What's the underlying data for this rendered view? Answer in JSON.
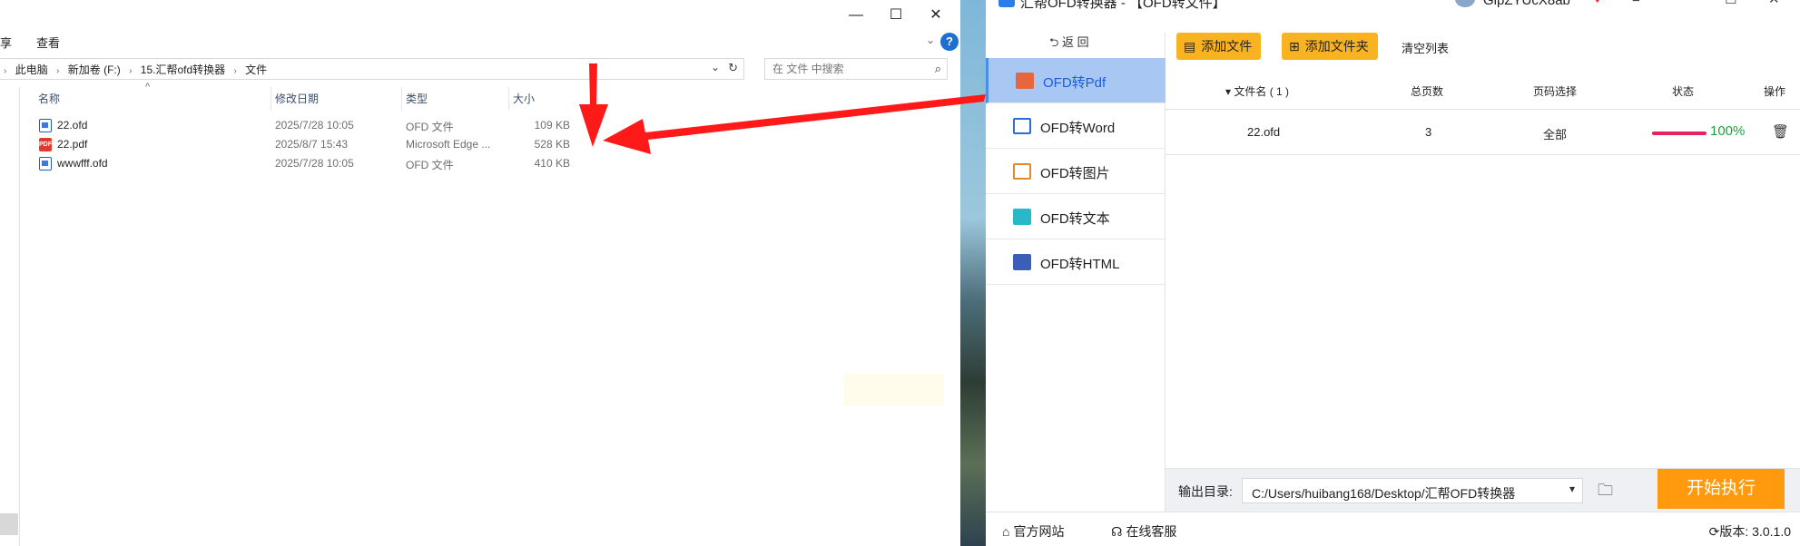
{
  "explorer": {
    "menu": {
      "share": "享",
      "view": "查看",
      "help": "?",
      "expand": "⌄"
    },
    "window_controls": {
      "minimize": "—",
      "maximize": "☐",
      "close": "✕"
    },
    "address": {
      "crumbs": [
        "此电脑",
        "新加卷 (F:)",
        "15.汇帮ofd转换器",
        "文件"
      ],
      "dropdown": "⌄",
      "refresh": "↻"
    },
    "search": {
      "placeholder": "在 文件 中搜索",
      "icon": "⌕"
    },
    "columns": {
      "name": "名称",
      "date": "修改日期",
      "type": "类型",
      "size": "大小",
      "sort": "^"
    },
    "files": [
      {
        "name": "22.ofd",
        "date": "2025/7/28 10:05",
        "type": "OFD 文件",
        "size": "109 KB",
        "icon": "ofd-file-icon"
      },
      {
        "name": "22.pdf",
        "date": "2025/8/7 15:43",
        "type": "Microsoft Edge ...",
        "size": "528 KB",
        "icon": "pdf-file-icon",
        "badge": "PDF"
      },
      {
        "name": "wwwfff.ofd",
        "date": "2025/7/28 10:05",
        "type": "OFD 文件",
        "size": "410 KB",
        "icon": "ofd-file-icon"
      }
    ]
  },
  "app": {
    "title": "汇帮OFD转换器 - 【OFD转文件】",
    "user": "GlpZYUcX8ab",
    "window_controls": {
      "menu": "≡",
      "minimize": "—",
      "maximize": "☐",
      "close": "✕"
    },
    "back": "⮌ 返 回",
    "sidebar": [
      {
        "label": "OFD转Pdf",
        "icon": "pdf-icon",
        "color": "#e8663d",
        "active": true
      },
      {
        "label": "OFD转Word",
        "icon": "word-icon",
        "color": "#2b6fd6"
      },
      {
        "label": "OFD转图片",
        "icon": "image-icon",
        "color": "#e08a2e"
      },
      {
        "label": "OFD转文本",
        "icon": "text-icon",
        "color": "#27b9c8"
      },
      {
        "label": "OFD转HTML",
        "icon": "html-icon",
        "color": "#3b5fb8"
      }
    ],
    "toolbar": {
      "add_file": "添加文件",
      "add_folder": "添加文件夹",
      "clear": "清空列表"
    },
    "table": {
      "headers": {
        "filename": "▾ 文件名 ( 1 )",
        "pages": "总页数",
        "range": "页码选择",
        "status": "状态",
        "action": "操作"
      },
      "rows": [
        {
          "filename": "22.ofd",
          "pages": "3",
          "range": "全部",
          "progress": 1.0,
          "progress_text": "100%"
        }
      ]
    },
    "output": {
      "label": "输出目录:",
      "path": "C:/Users/huibang168/Desktop/汇帮OFD转换器",
      "caret": "▾"
    },
    "start_button": "开始执行",
    "footer": {
      "website": "官方网站",
      "support": "在线客服",
      "version": "版本: 3.0.1.0"
    },
    "colors": {
      "accent": "#ff9a0e",
      "toolbar_button": "#f9b320",
      "selected_bg": "#a8c7f2",
      "progress": "#e6235d",
      "progress_text": "#1aa33a"
    }
  },
  "annotation_color": "#ff1a1a"
}
